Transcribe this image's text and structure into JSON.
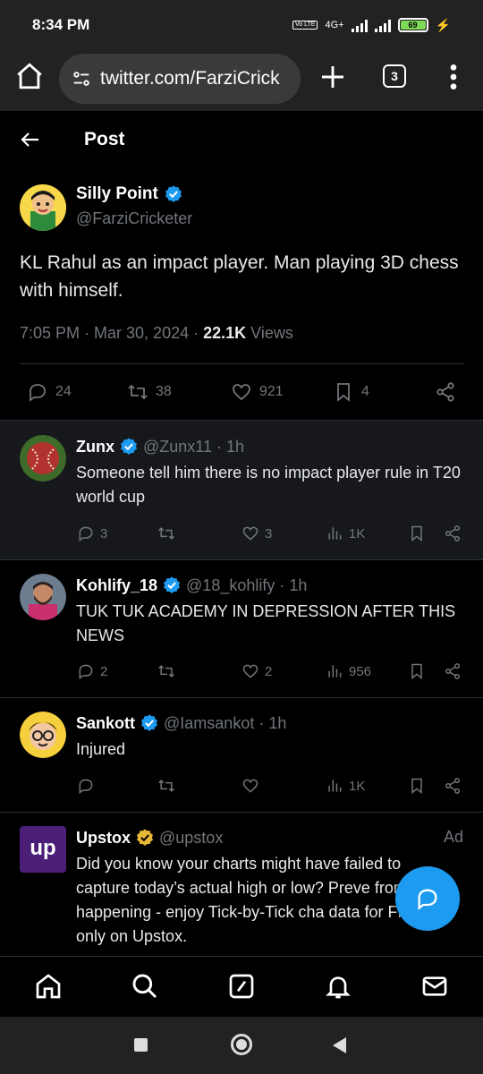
{
  "status_bar": {
    "time": "8:34 PM",
    "network": "4G+",
    "battery": "69",
    "volte": "Vo LTE"
  },
  "browser": {
    "url": "twitter.com/FarziCrick",
    "tab_count": "3"
  },
  "header": {
    "title": "Post"
  },
  "main_tweet": {
    "name": "Silly Point",
    "handle": "@FarziCricketer",
    "text": "KL Rahul as an impact player. Man playing 3D chess with himself.",
    "time": "7:05 PM · Mar 30, 2024 · ",
    "views_count": "22.1K",
    "views_label": " Views",
    "replies": "24",
    "reposts": "38",
    "likes": "921",
    "bookmarks": "4"
  },
  "replies": [
    {
      "name": "Zunx",
      "handle": "@Zunx11 · 1h",
      "text": "Someone tell him there is no impact player rule in T20 world cup",
      "replies": "3",
      "likes": "3",
      "views": "1K"
    },
    {
      "name": "Kohlify_18",
      "handle": "@18_kohlify · 1h",
      "text": "TUK TUK ACADEMY IN DEPRESSION AFTER THIS NEWS",
      "replies": "2",
      "likes": "2",
      "views": "956"
    },
    {
      "name": "Sankott",
      "handle": "@Iamsankot · 1h",
      "text": "Injured",
      "views": "1K"
    },
    {
      "name": "Upstox",
      "handle": "@upstox",
      "ad_label": "Ad",
      "text": "Did you know your charts might have failed to capture today’s actual high or low? Preve from happening - enjoy Tick-by-Tick cha data for FREE only on Upstox.",
      "logo_text": "up"
    }
  ],
  "colors": {
    "accent": "#1d9bf0",
    "gold_badge": "#e8b936",
    "muted": "#71767b"
  }
}
